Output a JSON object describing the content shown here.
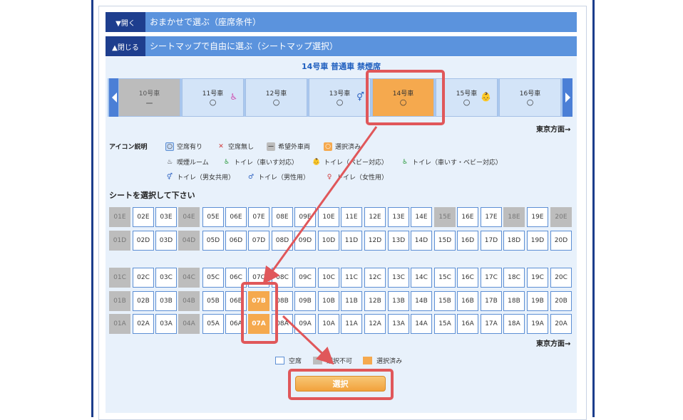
{
  "section_auto": {
    "toggle_label": "▼開く",
    "title": "おまかせで選ぶ（座席条件）"
  },
  "section_map": {
    "toggle_label": "▲閉じる",
    "title": "シートマップで自由に選ぶ（シートマップ選択）"
  },
  "car_title": "14号車 普通車 禁煙席",
  "cars": [
    {
      "name": "10号車",
      "status": "ー",
      "state": "unavailable"
    },
    {
      "name": "11号車",
      "status": "○",
      "state": "available",
      "icon": "wheelchair-babycare-toilet-icon"
    },
    {
      "name": "12号車",
      "status": "○",
      "state": "available"
    },
    {
      "name": "13号車",
      "status": "○",
      "state": "available",
      "icon": "unisex-toilet-icon"
    },
    {
      "name": "14号車",
      "status": "○",
      "state": "selected"
    },
    {
      "name": "15号車",
      "status": "○",
      "state": "available",
      "icon": "babycare-toilet-icon"
    },
    {
      "name": "16号車",
      "status": "○",
      "state": "available"
    }
  ],
  "direction_label": "東京方面→",
  "legend": {
    "title": "アイコン説明",
    "items": [
      "空席有り",
      "空席無し",
      "希望外車両",
      "選択済み",
      "喫煙ルーム",
      "トイレ（車いす対応）",
      "トイレ（ベビー対応）",
      "トイレ（車いす・ベビー対応）",
      "トイレ（男女共用）",
      "トイレ（男性用）",
      "トイレ（女性用）"
    ]
  },
  "seat_prompt": "シートを選択して下さい",
  "seat_rows": [
    "E",
    "D",
    "C",
    "B",
    "A"
  ],
  "seat_numbers": [
    "01",
    "02",
    "03",
    "04",
    "05",
    "06",
    "07",
    "08",
    "09",
    "10",
    "11",
    "12",
    "13",
    "14",
    "15",
    "16",
    "17",
    "18",
    "19",
    "20"
  ],
  "unavailable_seats": [
    "01E",
    "04E",
    "15E",
    "18E",
    "20E",
    "01D",
    "04D",
    "01C",
    "04C",
    "01B",
    "04B",
    "01A",
    "04A"
  ],
  "selected_seats": [
    "07B",
    "07A"
  ],
  "seat_key": {
    "vacant": "空席",
    "unavailable": "選択不可",
    "selected": "選択済み"
  },
  "select_button_label": "選択",
  "colors": {
    "accent": "#5b93dd",
    "nav": "#1e3e8e",
    "selected": "#f5a94e",
    "highlight": "#e0575a",
    "unavailable": "#bdbdbd"
  }
}
